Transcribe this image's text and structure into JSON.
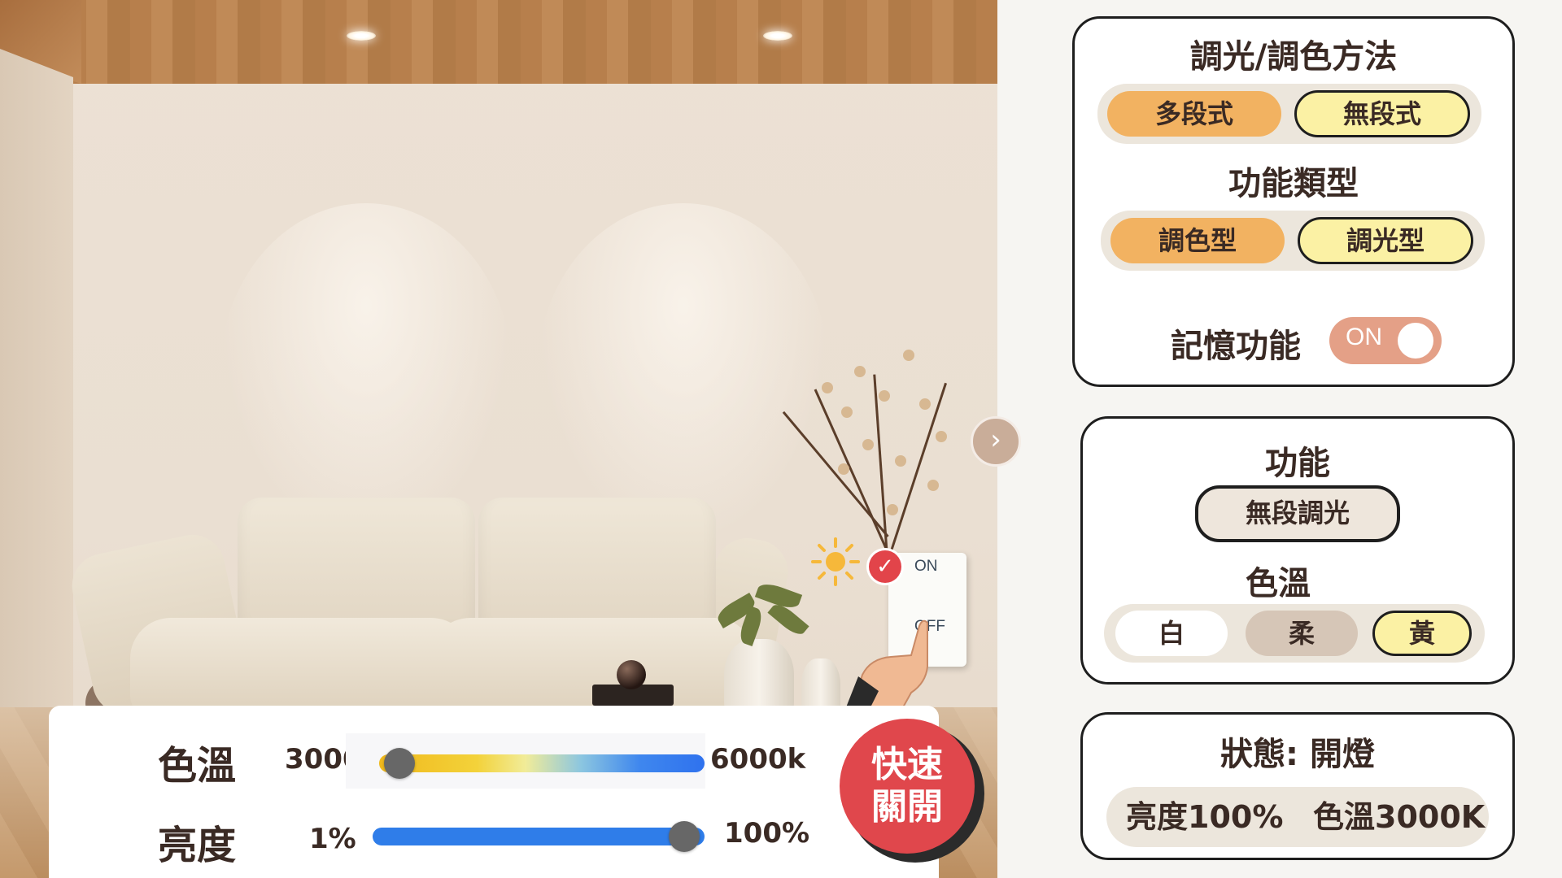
{
  "scene": {
    "switch_on_label": "ON",
    "switch_off_label": "OFF",
    "next_icon": "chevron-right-icon"
  },
  "controls": {
    "color_temp": {
      "label": "色溫",
      "min_label": "3000k",
      "max_label": "6000k",
      "value_fraction": 0.0
    },
    "brightness": {
      "label": "亮度",
      "min_label": "1%",
      "max_label": "100%",
      "value_fraction": 1.0
    },
    "quick_toggle": {
      "line1": "快速",
      "line2": "關開"
    }
  },
  "dimming_card": {
    "title": "調光/調色方法",
    "method_options": [
      "多段式",
      "無段式"
    ],
    "type_title": "功能類型",
    "type_options": [
      "調色型",
      "調光型"
    ],
    "memory_label": "記憶功能",
    "memory_toggle": "ON"
  },
  "function_card": {
    "title": "功能",
    "function_value": "無段調光",
    "color_temp_title": "色溫",
    "color_options": [
      "白",
      "柔",
      "黃"
    ]
  },
  "status_card": {
    "title": "狀態: 開燈",
    "brightness_text": "亮度100%",
    "color_temp_text": "色溫3000K"
  },
  "colors": {
    "accent_orange": "#f2b261",
    "accent_yellow": "#fbf1a4",
    "toggle_on": "#e4a087",
    "quick_red": "#e0474c",
    "slider_blue": "#2f7de9"
  }
}
